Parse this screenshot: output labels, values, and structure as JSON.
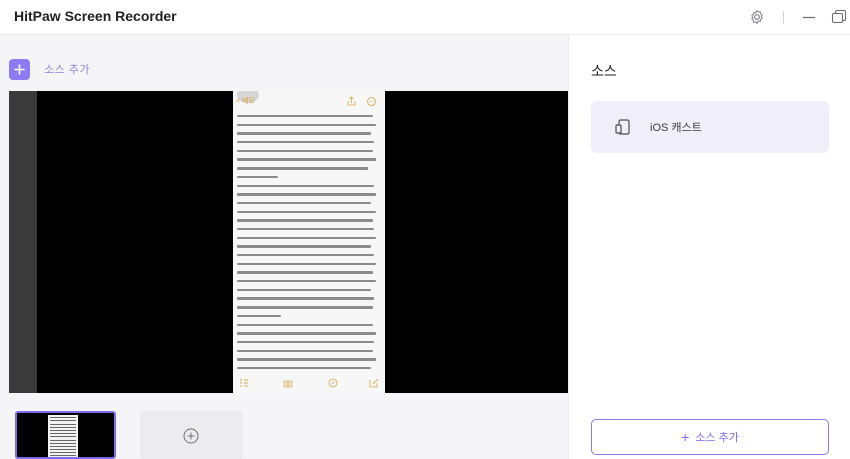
{
  "app": {
    "title": "HitPaw Screen Recorder"
  },
  "titlebar": {
    "icons": [
      "gear-icon",
      "minimize-icon",
      "maximize-icon"
    ]
  },
  "left": {
    "add_source_label": "소스 추가",
    "add_source_icon": "plus-icon"
  },
  "preview": {
    "phone": {
      "back_label": "< 메모",
      "toolbar_icons": [
        "share-icon",
        "more-icon"
      ],
      "bottom_icons": [
        "checklist-icon",
        "camera-icon",
        "pen-icon",
        "compose-icon"
      ]
    }
  },
  "thumbnails": {
    "add_icon": "add-circle-icon"
  },
  "right": {
    "title": "소스",
    "source_item": {
      "label": "iOS 캐스트",
      "icon": "ios-device-icon"
    },
    "add_source_label": "소스 추가"
  },
  "colors": {
    "accent": "#8c7bf2",
    "accent_text": "#7b6cf0",
    "panel_bg": "#f5f5f7",
    "card_bg": "#f0eff9"
  }
}
